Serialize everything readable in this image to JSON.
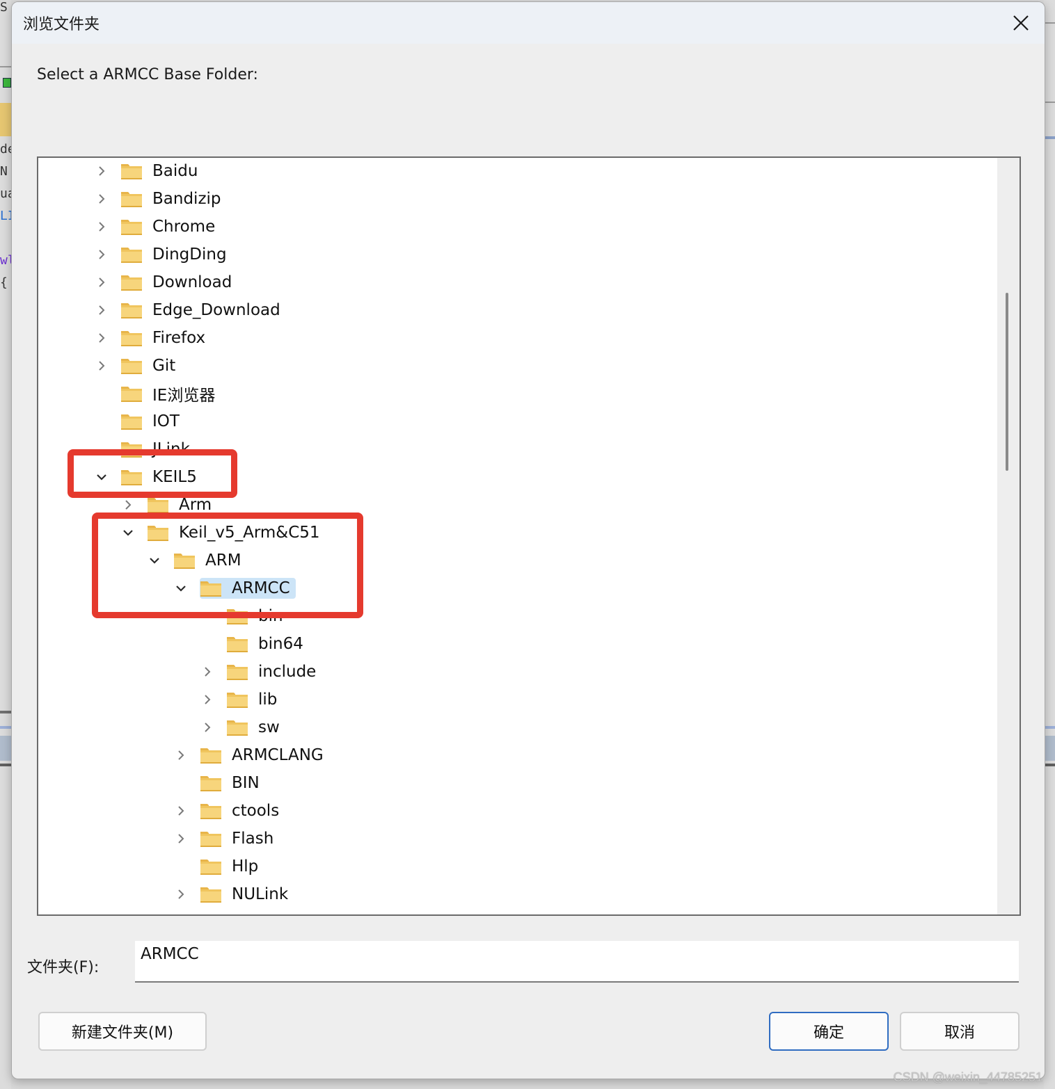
{
  "dialog": {
    "title": "浏览文件夹",
    "prompt": "Select a ARMCC Base Folder:",
    "close_icon": "close-icon"
  },
  "tree": {
    "items": [
      {
        "label": "Baidu",
        "level": 0,
        "expander": "collapsed"
      },
      {
        "label": "Bandizip",
        "level": 0,
        "expander": "collapsed"
      },
      {
        "label": "Chrome",
        "level": 0,
        "expander": "collapsed"
      },
      {
        "label": "DingDing",
        "level": 0,
        "expander": "collapsed"
      },
      {
        "label": "Download",
        "level": 0,
        "expander": "collapsed"
      },
      {
        "label": "Edge_Download",
        "level": 0,
        "expander": "collapsed"
      },
      {
        "label": "Firefox",
        "level": 0,
        "expander": "collapsed"
      },
      {
        "label": "Git",
        "level": 0,
        "expander": "collapsed"
      },
      {
        "label": "IE浏览器",
        "level": 0,
        "expander": "none"
      },
      {
        "label": "IOT",
        "level": 0,
        "expander": "none"
      },
      {
        "label": "JLink",
        "level": 0,
        "expander": "none"
      },
      {
        "label": "KEIL5",
        "level": 0,
        "expander": "expanded"
      },
      {
        "label": "Arm",
        "level": 1,
        "expander": "collapsed"
      },
      {
        "label": "Keil_v5_Arm&C51",
        "level": 1,
        "expander": "expanded"
      },
      {
        "label": "ARM",
        "level": 2,
        "expander": "expanded"
      },
      {
        "label": "ARMCC",
        "level": 3,
        "expander": "expanded",
        "selected": true
      },
      {
        "label": "bin",
        "level": 4,
        "expander": "none"
      },
      {
        "label": "bin64",
        "level": 4,
        "expander": "none"
      },
      {
        "label": "include",
        "level": 4,
        "expander": "collapsed"
      },
      {
        "label": "lib",
        "level": 4,
        "expander": "collapsed"
      },
      {
        "label": "sw",
        "level": 4,
        "expander": "collapsed"
      },
      {
        "label": "ARMCLANG",
        "level": 3,
        "expander": "collapsed"
      },
      {
        "label": "BIN",
        "level": 3,
        "expander": "none"
      },
      {
        "label": "ctools",
        "level": 3,
        "expander": "collapsed"
      },
      {
        "label": "Flash",
        "level": 3,
        "expander": "collapsed"
      },
      {
        "label": "Hlp",
        "level": 3,
        "expander": "none"
      },
      {
        "label": "NULink",
        "level": 3,
        "expander": "collapsed"
      }
    ]
  },
  "folder_field": {
    "label": "文件夹(F):",
    "value": "ARMCC"
  },
  "buttons": {
    "new_folder": "新建文件夹(M)",
    "ok": "确定",
    "cancel": "取消"
  },
  "annotations": {
    "highlight_color": "#e53a2e"
  },
  "colors": {
    "selection": "#cce4f7",
    "primary_button_border": "#2f6cc1",
    "folder": "#f5cf6b"
  },
  "watermark": "CSDN @weixin_44785251",
  "background_glyphs": [
    "S",
    "de",
    "N",
    "ua",
    "LI",
    "wl",
    "{"
  ]
}
